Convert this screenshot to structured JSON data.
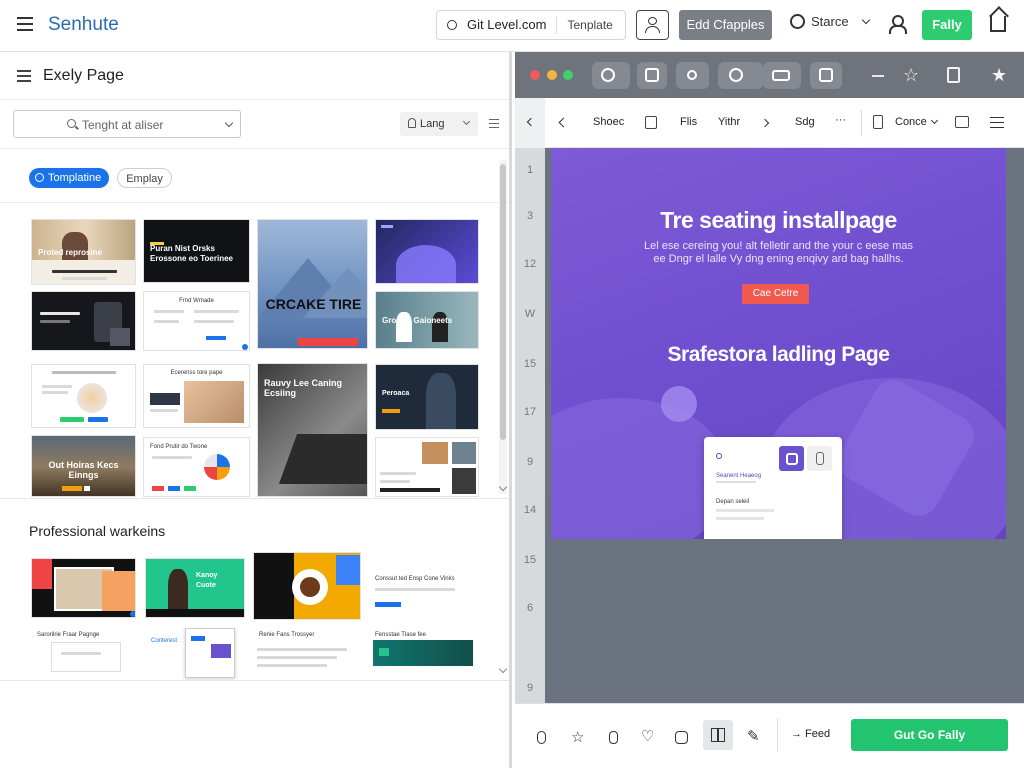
{
  "topbar": {
    "brand": "Senhute",
    "git_label": "Git Level.com",
    "template_label": "Tenplate",
    "edit_button": "Edd Cfapples",
    "status_label": "Starce",
    "primary_button": "Fally",
    "icons": [
      "hamburger-icon",
      "user-icon",
      "clock-icon",
      "chevron-down-icon",
      "person-icon",
      "home-icon"
    ]
  },
  "left": {
    "title": "Exely Page",
    "search_placeholder": "Tenght at aliser",
    "lang_label": "Lang",
    "chips": [
      "Tomplatine",
      "Emplay"
    ],
    "tiles": [
      {
        "label": "Proted reprosine"
      },
      {
        "label": "Puran Nist Orsks Erossone eo Toerinee"
      },
      {
        "label": "CRCAKE TIRE"
      },
      {
        "label": ""
      },
      {
        "label": ""
      },
      {
        "label": "Frnd Wmade"
      },
      {
        "label": "Grostor Gaioneets"
      },
      {
        "label": "Ws a Parets Peprgt"
      },
      {
        "label": "Ecerenss tore pape"
      },
      {
        "label": "Rauvy Lee Caning Ecsiing"
      },
      {
        "label": "Peroaca"
      },
      {
        "label": "Out Hoiras Kecs Einngs"
      },
      {
        "label": "Fond Prutir do Twone"
      },
      {
        "label": ""
      }
    ],
    "section_title": "Professional warkeins",
    "section_tiles": [
      {
        "label": ""
      },
      {
        "label": "Kanoy Cuote"
      },
      {
        "label": ""
      },
      {
        "label": "Conssut ted Ensp Cone Vinks"
      },
      {
        "label": "Sarorilrie Fraar Pagnge"
      },
      {
        "label": "Conterest"
      },
      {
        "label": "Renie Fans Trossyer"
      },
      {
        "label": "Fensstae Tlase fee"
      }
    ]
  },
  "right": {
    "toolbar_icons": [
      "clock-icon",
      "clipboard-icon",
      "share-icon",
      "comment-icon",
      "card-icon",
      "image-icon",
      "minimize-icon",
      "star-outline-icon",
      "trash-icon",
      "star-icon"
    ],
    "nav": [
      "Shoec",
      "Flis",
      "Yithr",
      "Sdg",
      "···",
      "Conce"
    ],
    "ruler": [
      "1",
      "3",
      "12",
      "W",
      "15",
      "17",
      "9",
      "14",
      "15",
      "6",
      "9"
    ],
    "canvas": {
      "heading": "Tre seating installpage",
      "subtext": "Lel ese cereing you! alt felletir and the your c eese mas ee Dngr el lalle Vy dng ening enqivy ard bag hallhs.",
      "cta": "Cae Cetre",
      "heading2": "Srafestora ladling Page",
      "card_title": "Seanent Heaeog",
      "card_text": "Depan seleil"
    },
    "bottom": {
      "feed_label": "→ Feed",
      "go_button": "Gut Go Fally"
    }
  },
  "colors": {
    "accent_blue": "#1a73e8",
    "brand_blue": "#2b6cb0",
    "green": "#2ecc71",
    "canvas_purple": "#7050d0",
    "cta_red": "#f05a4f"
  }
}
